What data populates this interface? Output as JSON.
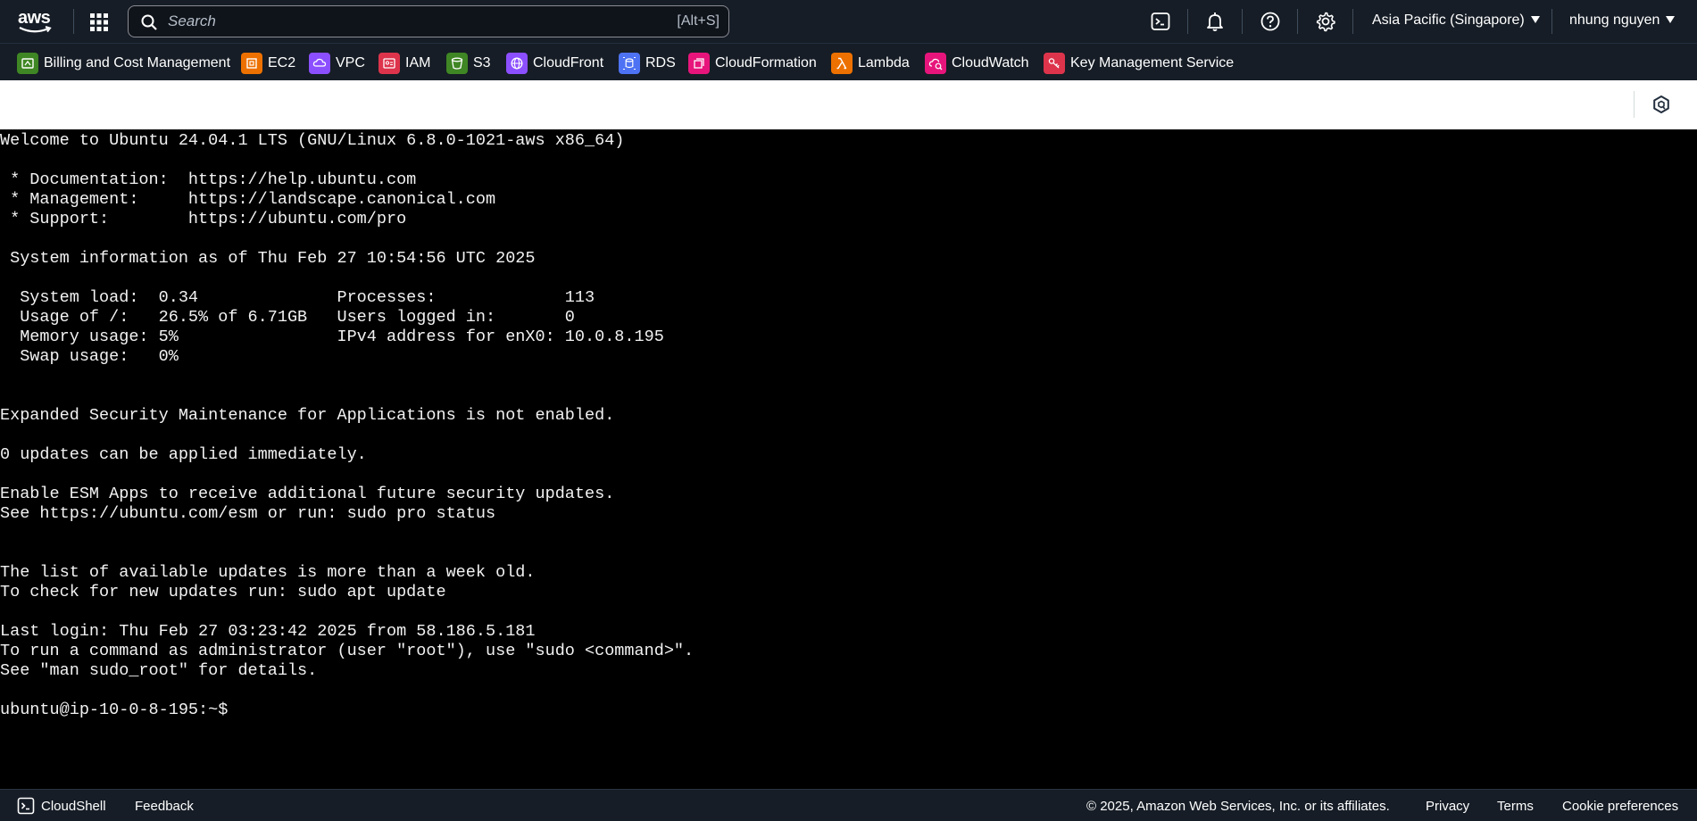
{
  "nav": {
    "logo_text": "aws",
    "search_placeholder": "Search",
    "search_shortcut": "[Alt+S]",
    "region": "Asia Pacific (Singapore)",
    "user": "nhung nguyen"
  },
  "favorites": [
    {
      "label": "Billing and Cost Management",
      "color": "#3f8624"
    },
    {
      "label": "EC2",
      "color": "#ed7100"
    },
    {
      "label": "VPC",
      "color": "#8c4fff"
    },
    {
      "label": "IAM",
      "color": "#dd344c"
    },
    {
      "label": "S3",
      "color": "#3f8624"
    },
    {
      "label": "CloudFront",
      "color": "#8c4fff"
    },
    {
      "label": "RDS",
      "color": "#4d72f3"
    },
    {
      "label": "CloudFormation",
      "color": "#e7157b"
    },
    {
      "label": "Lambda",
      "color": "#ed7100"
    },
    {
      "label": "CloudWatch",
      "color": "#e7157b"
    },
    {
      "label": "Key Management Service",
      "color": "#dd344c"
    }
  ],
  "terminal": {
    "lines": [
      "Welcome to Ubuntu 24.04.1 LTS (GNU/Linux 6.8.0-1021-aws x86_64)",
      "",
      " * Documentation:  https://help.ubuntu.com",
      " * Management:     https://landscape.canonical.com",
      " * Support:        https://ubuntu.com/pro",
      "",
      " System information as of Thu Feb 27 10:54:56 UTC 2025",
      "",
      "  System load:  0.34              Processes:             113",
      "  Usage of /:   26.5% of 6.71GB   Users logged in:       0",
      "  Memory usage: 5%                IPv4 address for enX0: 10.0.8.195",
      "  Swap usage:   0%",
      "",
      "",
      "Expanded Security Maintenance for Applications is not enabled.",
      "",
      "0 updates can be applied immediately.",
      "",
      "Enable ESM Apps to receive additional future security updates.",
      "See https://ubuntu.com/esm or run: sudo pro status",
      "",
      "",
      "The list of available updates is more than a week old.",
      "To check for new updates run: sudo apt update",
      "",
      "Last login: Thu Feb 27 03:23:42 2025 from 58.186.5.181",
      "To run a command as administrator (user \"root\"), use \"sudo <command>\".",
      "See \"man sudo_root\" for details.",
      "",
      "ubuntu@ip-10-0-8-195:~$"
    ]
  },
  "footer": {
    "cloudshell": "CloudShell",
    "feedback": "Feedback",
    "copyright": "© 2025, Amazon Web Services, Inc. or its affiliates.",
    "privacy": "Privacy",
    "terms": "Terms",
    "cookie": "Cookie preferences"
  },
  "colors": {
    "nav_bg": "#161d26",
    "terminal_bg": "#000000",
    "terminal_fg": "#f2f2f2"
  }
}
